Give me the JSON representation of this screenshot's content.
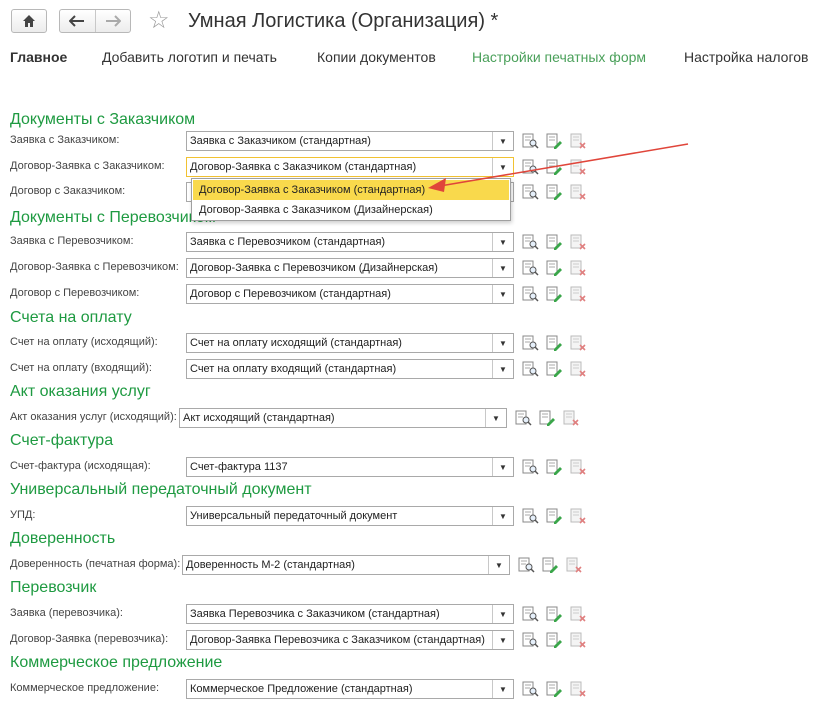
{
  "header": {
    "home_icon": "home-icon",
    "back_icon": "arrow-left-icon",
    "forward_icon": "arrow-right-icon",
    "star_icon": "star-icon",
    "title": "Умная Логистика (Организация) *"
  },
  "tabs": [
    {
      "label": "Главное",
      "active": true
    },
    {
      "label": "Добавить логотип и печать"
    },
    {
      "label": "Копии документов"
    },
    {
      "label": "Настройки печатных форм",
      "highlight": true
    },
    {
      "label": "Настройка налогов"
    }
  ],
  "sections": [
    {
      "title": "Документы с Заказчиком",
      "rows": [
        {
          "label": "Заявка с Заказчиком:",
          "value": "Заявка с Заказчиком (стандартная)"
        },
        {
          "label": "Договор-Заявка с Заказчиком:",
          "value": "Договор-Заявка с Заказчиком (стандартная)"
        },
        {
          "label": "Договор с Заказчиком:",
          "value": ""
        }
      ]
    },
    {
      "title": "Документы с Перевозчиком",
      "rows": [
        {
          "label": "Заявка с Перевозчиком:",
          "value": "Заявка с Перевозчиком (стандартная)"
        },
        {
          "label": "Договор-Заявка с Перевозчиком:",
          "value": "Договор-Заявка с Перевозчиком (Дизайнерская)"
        },
        {
          "label": "Договор с Перевозчиком:",
          "value": "Договор с Перевозчиком (стандартная)"
        }
      ]
    },
    {
      "title": "Счета на оплату",
      "rows": [
        {
          "label": "Счет на оплату (исходящий):",
          "value": "Счет на оплату исходящий (стандартная)"
        },
        {
          "label": "Счет на оплату (входящий):",
          "value": "Счет на оплату входящий (стандартная)"
        }
      ]
    },
    {
      "title": "Акт оказания услуг",
      "rows": [
        {
          "label": "Акт оказания услуг (исходящий):",
          "value": "Акт исходящий (стандартная)"
        }
      ]
    },
    {
      "title": "Счет-фактура",
      "rows": [
        {
          "label": "Счет-фактура (исходящая):",
          "value": "Счет-фактура 1137"
        }
      ]
    },
    {
      "title": "Универсальный передаточный документ",
      "rows": [
        {
          "label": "УПД:",
          "value": "Универсальный передаточный документ"
        }
      ]
    },
    {
      "title": "Доверенность",
      "rows": [
        {
          "label": "Доверенность (печатная форма):",
          "value": "Доверенность М-2 (стандартная)"
        }
      ]
    },
    {
      "title": "Перевозчик",
      "rows": [
        {
          "label": "Заявка (перевозчика):",
          "value": "Заявка Перевозчика с Заказчиком (стандартная)"
        },
        {
          "label": "Договор-Заявка (перевозчика):",
          "value": "Договор-Заявка Перевозчика с Заказчиком (стандартная)"
        }
      ]
    },
    {
      "title": "Коммерческое предложение",
      "rows": [
        {
          "label": "Коммерческое предложение:",
          "value": "Коммерческое Предложение (стандартная)"
        }
      ]
    }
  ],
  "dropdown": {
    "options": [
      {
        "label": "Договор-Заявка с Заказчиком (стандартная)",
        "selected": true
      },
      {
        "label": "Договор-Заявка с Заказчиком (Дизайнерская)"
      }
    ]
  },
  "row_icons": [
    "preview-icon",
    "edit-icon",
    "delete-icon"
  ],
  "colors": {
    "section": "#1e9a41",
    "selected_option": "#f9d94c",
    "annotation_arrow": "#e0453a"
  }
}
